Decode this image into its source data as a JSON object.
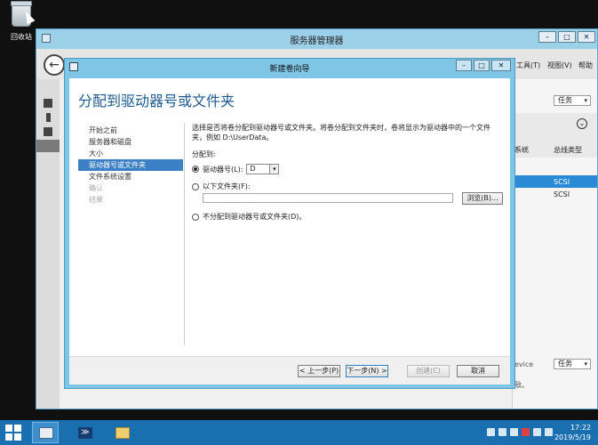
{
  "desktop": {
    "recycle_bin_label": "回收站"
  },
  "server_manager": {
    "title": "服务器管理器",
    "menu": {
      "tools": "工具(T)",
      "view": "视图(V)",
      "help": "帮助"
    },
    "tasks_label": "任务",
    "columns": {
      "system": "系统",
      "bus_type": "总线类型"
    },
    "rows": [
      {
        "bus_type": "SCSI"
      },
      {
        "bus_type": "SCSI"
      }
    ],
    "device_text": "evice",
    "bottom_text": "敌。"
  },
  "wizard": {
    "title": "新建卷向导",
    "heading": "分配到驱动器号或文件夹",
    "nav": [
      {
        "label": "开始之前",
        "state": "normal"
      },
      {
        "label": "服务器和磁盘",
        "state": "normal"
      },
      {
        "label": "大小",
        "state": "normal"
      },
      {
        "label": "驱动器号或文件夹",
        "state": "active"
      },
      {
        "label": "文件系统设置",
        "state": "normal"
      },
      {
        "label": "确认",
        "state": "disabled"
      },
      {
        "label": "结果",
        "state": "disabled"
      }
    ],
    "description": "选择是否将卷分配到驱动器号或文件夹。将卷分配到文件夹时，卷将显示为驱动器中的一个文件夹，例如 D:\\UserData。",
    "assign_to_label": "分配到:",
    "options": {
      "drive_letter_label": "驱动器号(L):",
      "drive_letter_value": "D",
      "folder_label": "以下文件夹(F):",
      "folder_value": "",
      "none_label": "不分配到驱动器号或文件夹(D)。",
      "selected": "drive_letter"
    },
    "browse_button": "浏览(B)...",
    "buttons": {
      "back": "< 上一步(P)",
      "next": "下一步(N) >",
      "create": "创建(C)",
      "cancel": "取消"
    }
  },
  "taskbar": {
    "time": "17:22",
    "date": "2019/5/19"
  }
}
